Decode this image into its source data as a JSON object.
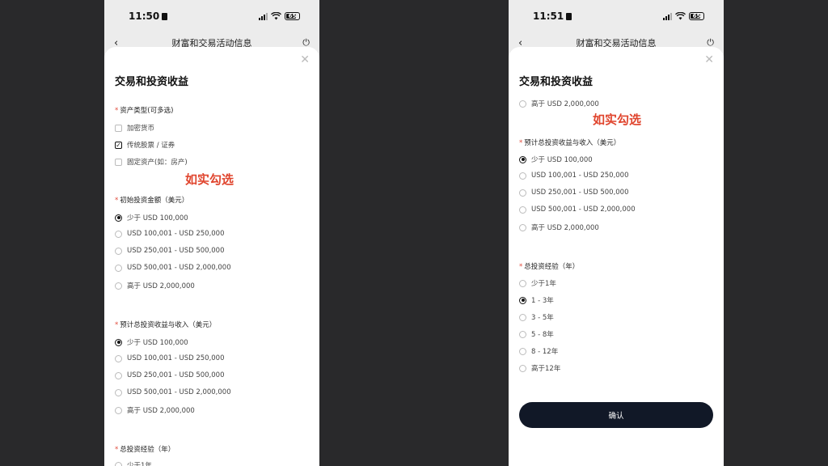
{
  "status": {
    "left_time": "11:50",
    "right_time": "11:51",
    "battery": "65"
  },
  "nav": {
    "title": "财富和交易活动信息",
    "back": "‹",
    "power": "⏻"
  },
  "sheet": {
    "title": "交易和投资收益",
    "close": "✕"
  },
  "asset_types": {
    "label": "资产类型(可多选)",
    "options": [
      {
        "label": "加密货币",
        "checked": false
      },
      {
        "label": "传统股票 / 证券",
        "checked": true
      },
      {
        "label": "固定资产(如：房产)",
        "checked": false
      }
    ]
  },
  "annotation": "如实勾选",
  "initial_investment": {
    "label": "初始投资金额（美元）",
    "options": [
      "少于 USD 100,000",
      "USD 100,001 - USD 250,000",
      "USD 250,001 - USD 500,000",
      "USD 500,001 - USD 2,000,000",
      "高于 USD 2,000,000"
    ],
    "selected": 0
  },
  "expected_income": {
    "label": "预计总投资收益与收入（美元）",
    "options": [
      "少于 USD 100,000",
      "USD 100,001 - USD 250,000",
      "USD 250,001 - USD 500,000",
      "USD 500,001 - USD 2,000,000",
      "高于 USD 2,000,000"
    ],
    "selected": 0
  },
  "experience": {
    "label": "总投资经验（年）",
    "options": [
      "少于1年",
      "1 - 3年",
      "3 - 5年",
      "5 - 8年",
      "8 - 12年",
      "高于12年"
    ],
    "selected": 1
  },
  "confirm_label": "确认",
  "icons": {
    "wifi": "wifi-icon",
    "signal": "signal-icon",
    "battery": "battery-icon",
    "back": "chevron-left-icon",
    "power": "power-icon",
    "close": "close-icon"
  },
  "colors": {
    "accent": "#e0452e",
    "button": "#111827",
    "backdrop": "#29292b"
  }
}
